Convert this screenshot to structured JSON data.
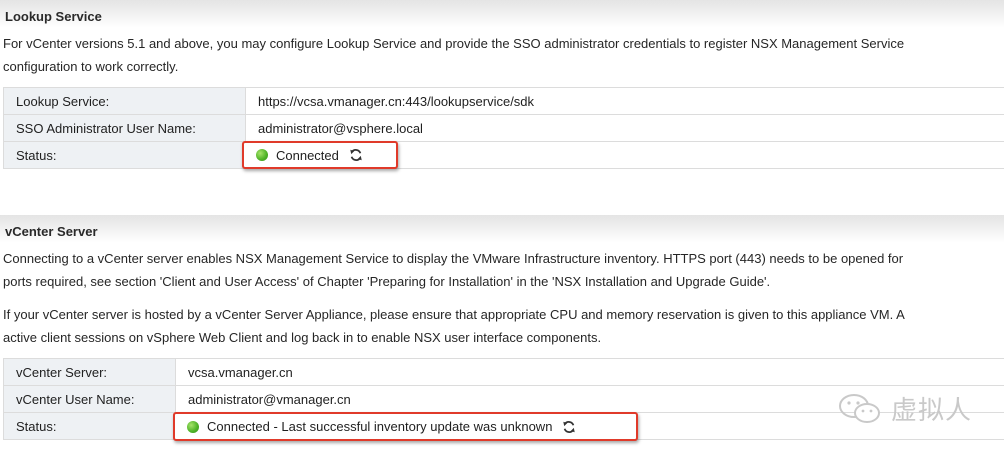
{
  "lookup": {
    "title": "Lookup Service",
    "desc_line1": "For vCenter versions 5.1 and above, you may configure Lookup Service and provide the SSO administrator credentials to register NSX Management Service",
    "desc_line2": "configuration to work correctly.",
    "rows": [
      {
        "label": "Lookup Service:",
        "value": "https://vcsa.vmanager.cn:443/lookupservice/sdk"
      },
      {
        "label": "SSO Administrator User Name:",
        "value": "administrator@vsphere.local"
      },
      {
        "label": "Status:",
        "value": "Connected"
      }
    ]
  },
  "vcenter": {
    "title": "vCenter Server",
    "para1_line1": "Connecting to a vCenter server enables NSX Management Service to display the VMware Infrastructure inventory. HTTPS port (443) needs to be opened for",
    "para1_line2": "ports required, see section 'Client and User Access' of Chapter 'Preparing for Installation' in the 'NSX Installation and Upgrade Guide'.",
    "para2_line1": "If your vCenter server is hosted by a vCenter Server Appliance, please ensure that appropriate CPU and memory reservation is given to this appliance VM. A",
    "para2_line2": "active client sessions on vSphere Web Client and log back in to enable NSX user interface components.",
    "rows": [
      {
        "label": "vCenter Server:",
        "value": "vcsa.vmanager.cn"
      },
      {
        "label": "vCenter User Name:",
        "value": "administrator@vmanager.cn"
      },
      {
        "label": "Status:",
        "value": "Connected - Last successful inventory update was unknown"
      }
    ]
  },
  "watermark": {
    "text": "虚拟人",
    "icon": "wechat-icon"
  },
  "colors": {
    "highlight_border": "#e03a2a",
    "status_ok": "#52b52a",
    "label_bg": "#eef1f4"
  }
}
